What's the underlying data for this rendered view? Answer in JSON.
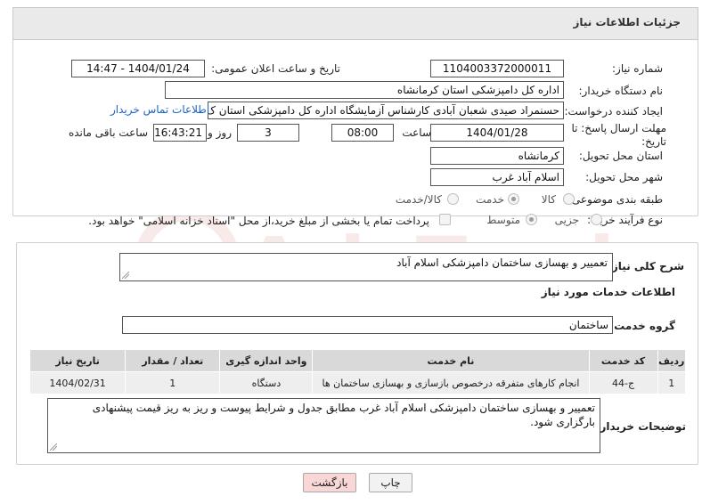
{
  "header": {
    "title": "جزئیات اطلاعات نیاز"
  },
  "form": {
    "need_number_label": "شماره نیاز:",
    "need_number": "1104003372000011",
    "announce_label": "تاریخ و ساعت اعلان عمومی:",
    "announce_value": "1404/01/24 - 14:47",
    "buyer_org_label": "نام دستگاه خریدار:",
    "buyer_org": "اداره کل دامپزشکی استان کرمانشاه",
    "creator_label": "ایجاد کننده درخواست:",
    "creator": "حسنمراد صیدی شعبان آبادی کارشناس آزمایشگاه اداره کل دامپزشکی استان ک",
    "contact_link": "اطلاعات تماس خریدار",
    "deadline_label": "مهلت ارسال پاسخ: تا تاریخ:",
    "deadline_date": "1404/01/28",
    "time_label": "ساعت",
    "deadline_time": "08:00",
    "days_value": "3",
    "days_label": "روز و",
    "remaining_time": "16:43:21",
    "remaining_label": "ساعت باقی مانده",
    "province_label": "استان محل تحویل:",
    "province": "کرمانشاه",
    "city_label": "شهر محل تحویل:",
    "city": "اسلام آباد غرب",
    "category_label": "طبقه بندی موضوعی:",
    "category_options": [
      "کالا",
      "خدمت",
      "کالا/خدمت"
    ],
    "category_selected": "خدمت",
    "process_label": "نوع فرآیند خرید :",
    "process_options": [
      "جزیی",
      "متوسط"
    ],
    "process_selected": "متوسط",
    "payment_note": "پرداخت تمام یا بخشی از مبلغ خرید،از محل \"اسناد خزانه اسلامی\" خواهد بود."
  },
  "summary": {
    "label": "شرح کلی نیاز:",
    "value": "تعمییر و بهسازی ساختمان دامپزشکی اسلام آباد"
  },
  "services": {
    "section_title": "اطلاعات خدمات مورد نیاز",
    "group_label": "گروه خدمت:",
    "group_value": "ساختمان",
    "columns": [
      "ردیف",
      "کد خدمت",
      "نام خدمت",
      "واحد اندازه گیری",
      "تعداد / مقدار",
      "تاریخ نیاز"
    ],
    "rows": [
      [
        "1",
        "ج-44",
        "انجام کارهای متفرقه درخصوص بازسازی و بهسازی ساختمان ها",
        "دستگاه",
        "1",
        "1404/02/31"
      ]
    ]
  },
  "buyer_notes": {
    "label": "توضیحات خریدار:",
    "value": "تعمییر و بهسازی ساختمان دامپزشکی اسلام آباد غرب مطابق جدول و شرایط پیوست و ریز به ریز قیمت پیشنهادی بارگزاری شود."
  },
  "buttons": {
    "print": "چاپ",
    "back": "بازگشت"
  },
  "watermark": {
    "text": "AriaTender.net"
  }
}
